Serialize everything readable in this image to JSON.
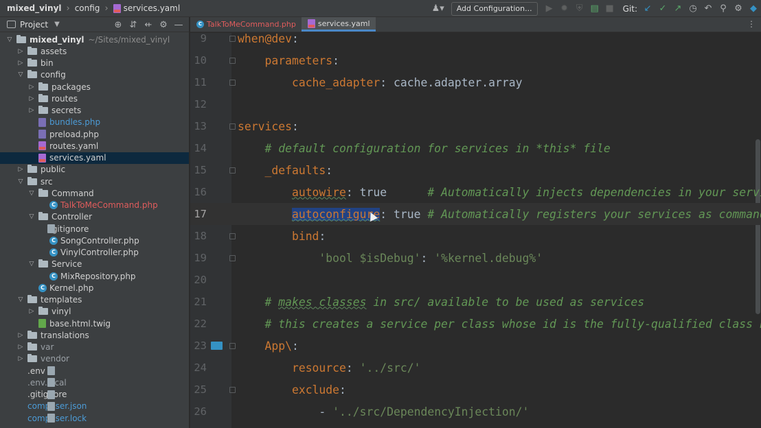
{
  "titlebar": {
    "breadcrumbs": [
      "mixed_vinyl",
      "config",
      "services.yaml"
    ],
    "add_config_label": "Add Configuration...",
    "git_label": "Git:"
  },
  "project": {
    "title": "Project",
    "tree": [
      {
        "label": "mixed_vinyl",
        "extra": "~/Sites/mixed_vinyl",
        "depth": 0,
        "type": "folder",
        "open": true,
        "style": "bold"
      },
      {
        "label": "assets",
        "depth": 1,
        "type": "folder",
        "open": false
      },
      {
        "label": "bin",
        "depth": 1,
        "type": "folder",
        "open": false
      },
      {
        "label": "config",
        "depth": 1,
        "type": "folder",
        "open": true
      },
      {
        "label": "packages",
        "depth": 2,
        "type": "folder",
        "open": false
      },
      {
        "label": "routes",
        "depth": 2,
        "type": "folder",
        "open": false
      },
      {
        "label": "secrets",
        "depth": 2,
        "type": "folder",
        "open": false
      },
      {
        "label": "bundles.php",
        "depth": 2,
        "type": "php",
        "style": "blue"
      },
      {
        "label": "preload.php",
        "depth": 2,
        "type": "php"
      },
      {
        "label": "routes.yaml",
        "depth": 2,
        "type": "yaml"
      },
      {
        "label": "services.yaml",
        "depth": 2,
        "type": "yaml",
        "selected": true
      },
      {
        "label": "public",
        "depth": 1,
        "type": "folder",
        "open": false
      },
      {
        "label": "src",
        "depth": 1,
        "type": "folder",
        "open": true
      },
      {
        "label": "Command",
        "depth": 2,
        "type": "folder",
        "open": true
      },
      {
        "label": "TalkToMeCommand.php",
        "depth": 3,
        "type": "class",
        "style": "red"
      },
      {
        "label": "Controller",
        "depth": 2,
        "type": "folder",
        "open": true
      },
      {
        "label": ".gitignore",
        "depth": 3,
        "type": "txt"
      },
      {
        "label": "SongController.php",
        "depth": 3,
        "type": "class"
      },
      {
        "label": "VinylController.php",
        "depth": 3,
        "type": "class"
      },
      {
        "label": "Service",
        "depth": 2,
        "type": "folder",
        "open": true
      },
      {
        "label": "MixRepository.php",
        "depth": 3,
        "type": "class"
      },
      {
        "label": "Kernel.php",
        "depth": 2,
        "type": "class"
      },
      {
        "label": "templates",
        "depth": 1,
        "type": "folder",
        "open": true
      },
      {
        "label": "vinyl",
        "depth": 2,
        "type": "folder",
        "open": false
      },
      {
        "label": "base.html.twig",
        "depth": 2,
        "type": "twig"
      },
      {
        "label": "translations",
        "depth": 1,
        "type": "folder",
        "open": false
      },
      {
        "label": "var",
        "depth": 1,
        "type": "folder",
        "open": false,
        "style": "grey"
      },
      {
        "label": "vendor",
        "depth": 1,
        "type": "folder",
        "open": false,
        "style": "grey"
      },
      {
        "label": ".env",
        "depth": 1,
        "type": "txt"
      },
      {
        "label": ".env.local",
        "depth": 1,
        "type": "txt",
        "style": "grey"
      },
      {
        "label": ".gitignore",
        "depth": 1,
        "type": "txt"
      },
      {
        "label": "composer.json",
        "depth": 1,
        "type": "txt",
        "style": "blue"
      },
      {
        "label": "composer.lock",
        "depth": 1,
        "type": "txt",
        "style": "blue"
      }
    ]
  },
  "editor": {
    "tabs": [
      {
        "label": "TalkToMeCommand.php",
        "active": false,
        "style": "red"
      },
      {
        "label": "services.yaml",
        "active": true
      }
    ],
    "lines": [
      {
        "n": "9",
        "html": "<span class=\"k\">when@dev</span><span class=\"v\">:</span>",
        "fold": true
      },
      {
        "n": "10",
        "html": "    <span class=\"k\">parameters</span><span class=\"v\">:</span>",
        "fold": true
      },
      {
        "n": "11",
        "html": "        <span class=\"k\">cache_adapter</span><span class=\"v\">: cache.adapter.array</span>",
        "fold": true
      },
      {
        "n": "12",
        "html": ""
      },
      {
        "n": "13",
        "html": "<span class=\"k\">services</span><span class=\"v\">:</span>",
        "fold": true
      },
      {
        "n": "14",
        "html": "    <span class=\"c\"># default configuration for services in *this* file</span>"
      },
      {
        "n": "15",
        "html": "    <span class=\"k\">_defaults</span><span class=\"v\">:</span>",
        "fold": true
      },
      {
        "n": "16",
        "html": "        <span class=\"k squig\">autowire</span><span class=\"v\">: true      </span><span class=\"c\"># Automatically injects dependencies in your services.</span>"
      },
      {
        "n": "17",
        "html": "        <span class=\"k squig sel\">autoconfigure</span><span class=\"v\">: true </span><span class=\"c\"># Automatically registers your services as commands, event subscribers, etc.</span>",
        "current": true
      },
      {
        "n": "18",
        "html": "        <span class=\"k\">bind</span><span class=\"v\">:</span>",
        "fold": true
      },
      {
        "n": "19",
        "html": "            <span class=\"s\">'bool $isDebug'</span><span class=\"v\">: </span><span class=\"s\">'%kernel.debug%'</span>",
        "fold": true
      },
      {
        "n": "20",
        "html": ""
      },
      {
        "n": "21",
        "html": "    <span class=\"c\"># <span class=\"squig\">makes classes</span> in src/ available to be used as services</span>"
      },
      {
        "n": "22",
        "html": "    <span class=\"c\"># this creates a service per class whose id is the fully-qualified class name</span>"
      },
      {
        "n": "23",
        "html": "    <span class=\"k\">App\\</span><span class=\"v\">:</span>",
        "fold": true,
        "gutter_folder": true
      },
      {
        "n": "24",
        "html": "        <span class=\"k\">resource</span><span class=\"v\">: </span><span class=\"s\">'../src/'</span>"
      },
      {
        "n": "25",
        "html": "        <span class=\"k\">exclude</span><span class=\"v\">:</span>",
        "fold": true
      },
      {
        "n": "26",
        "html": "            <span class=\"v\">- </span><span class=\"s\">'../src/DependencyInjection/'</span>"
      }
    ]
  }
}
